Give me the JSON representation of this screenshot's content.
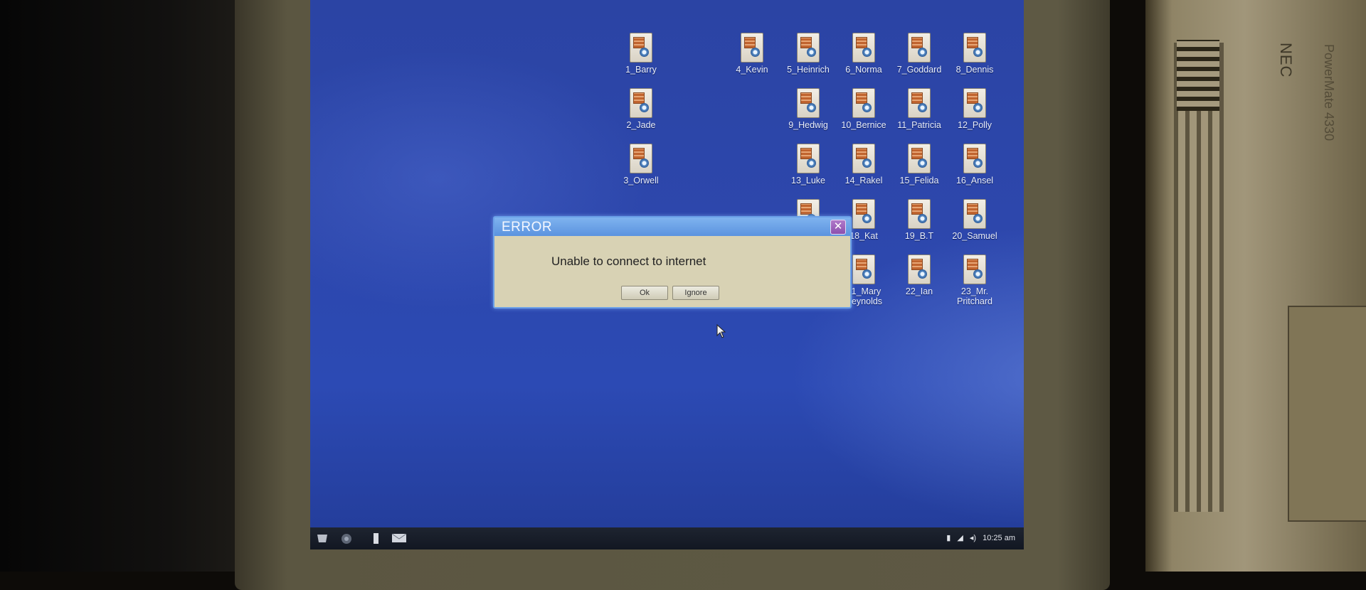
{
  "monitor": {
    "case_brand": "NEC",
    "case_model": "PowerMate 4330"
  },
  "desktop": {
    "icons": [
      {
        "label": "1_Barry"
      },
      {
        "label": "2_Jade"
      },
      {
        "label": "3_Orwell"
      },
      {
        "label": "4_Kevin"
      },
      {
        "label": "5_Heinrich"
      },
      {
        "label": "6_Norma"
      },
      {
        "label": "7_Goddard"
      },
      {
        "label": "8_Dennis"
      },
      {
        "label": "9_Hedwig"
      },
      {
        "label": "10_Bernice"
      },
      {
        "label": "11_Patricia"
      },
      {
        "label": "12_Polly"
      },
      {
        "label": "13_Luke"
      },
      {
        "label": "14_Rakel"
      },
      {
        "label": "15_Felida"
      },
      {
        "label": "16_Ansel"
      },
      {
        "label": "18_Kat"
      },
      {
        "label": "19_B.T"
      },
      {
        "label": "20_Samuel"
      },
      {
        "label": "21_Mary Reynolds"
      },
      {
        "label": "22_Ian"
      },
      {
        "label": "23_Mr. Pritchard"
      }
    ]
  },
  "dialog": {
    "title": "ERROR",
    "message": "Unable to connect to internet",
    "ok_label": "Ok",
    "ignore_label": "Ignore",
    "close_glyph": "✕"
  },
  "taskbar": {
    "icons": [
      "menu-icon",
      "browser-icon",
      "file-icon",
      "mail-icon"
    ],
    "clock": "10:25 am"
  }
}
